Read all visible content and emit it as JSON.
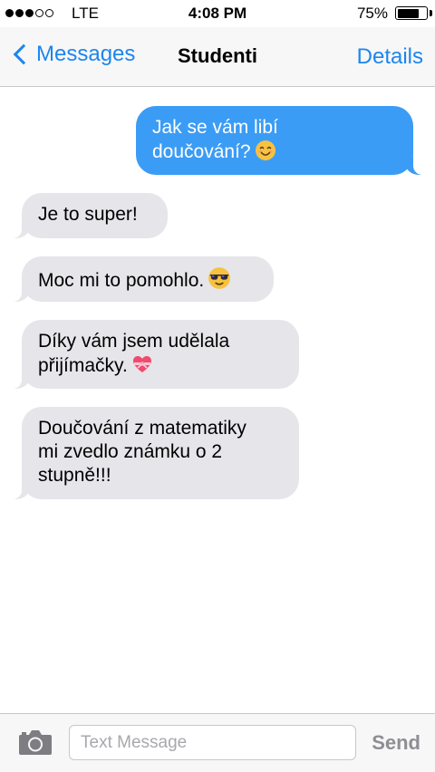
{
  "status_bar": {
    "carrier": "LTE",
    "time": "4:08 PM",
    "battery": "75%",
    "battery_level": 0.75,
    "signal_bars": 3,
    "signal_total": 5
  },
  "nav": {
    "back_label": "Messages",
    "title": "Studenti",
    "details_label": "Details"
  },
  "messages": [
    {
      "direction": "outgoing",
      "lines": [
        "Jak se vám libí",
        "doučování?"
      ],
      "emoji": "smiling-face-icon"
    },
    {
      "direction": "incoming",
      "lines": [
        "Je to super!"
      ]
    },
    {
      "direction": "incoming",
      "lines": [
        "Moc mi to pomohlo."
      ],
      "emoji": "sunglasses-face-icon"
    },
    {
      "direction": "incoming",
      "lines": [
        "Díky vám jsem udělala",
        "přijímačky."
      ],
      "emoji": "heart-with-ribbon-icon"
    },
    {
      "direction": "incoming",
      "lines": [
        "Doučování z matematiky",
        "mi zvedlo známku o 2",
        "stupně!!!"
      ]
    }
  ],
  "input": {
    "placeholder": "Text Message",
    "value": "",
    "send_label": "Send",
    "camera_icon": "camera-icon"
  },
  "colors": {
    "accent": "#1c86ee",
    "outgoing_bubble": "#3b9cf5",
    "incoming_bubble": "#e6e5ea",
    "send_disabled": "#8e8e93"
  }
}
